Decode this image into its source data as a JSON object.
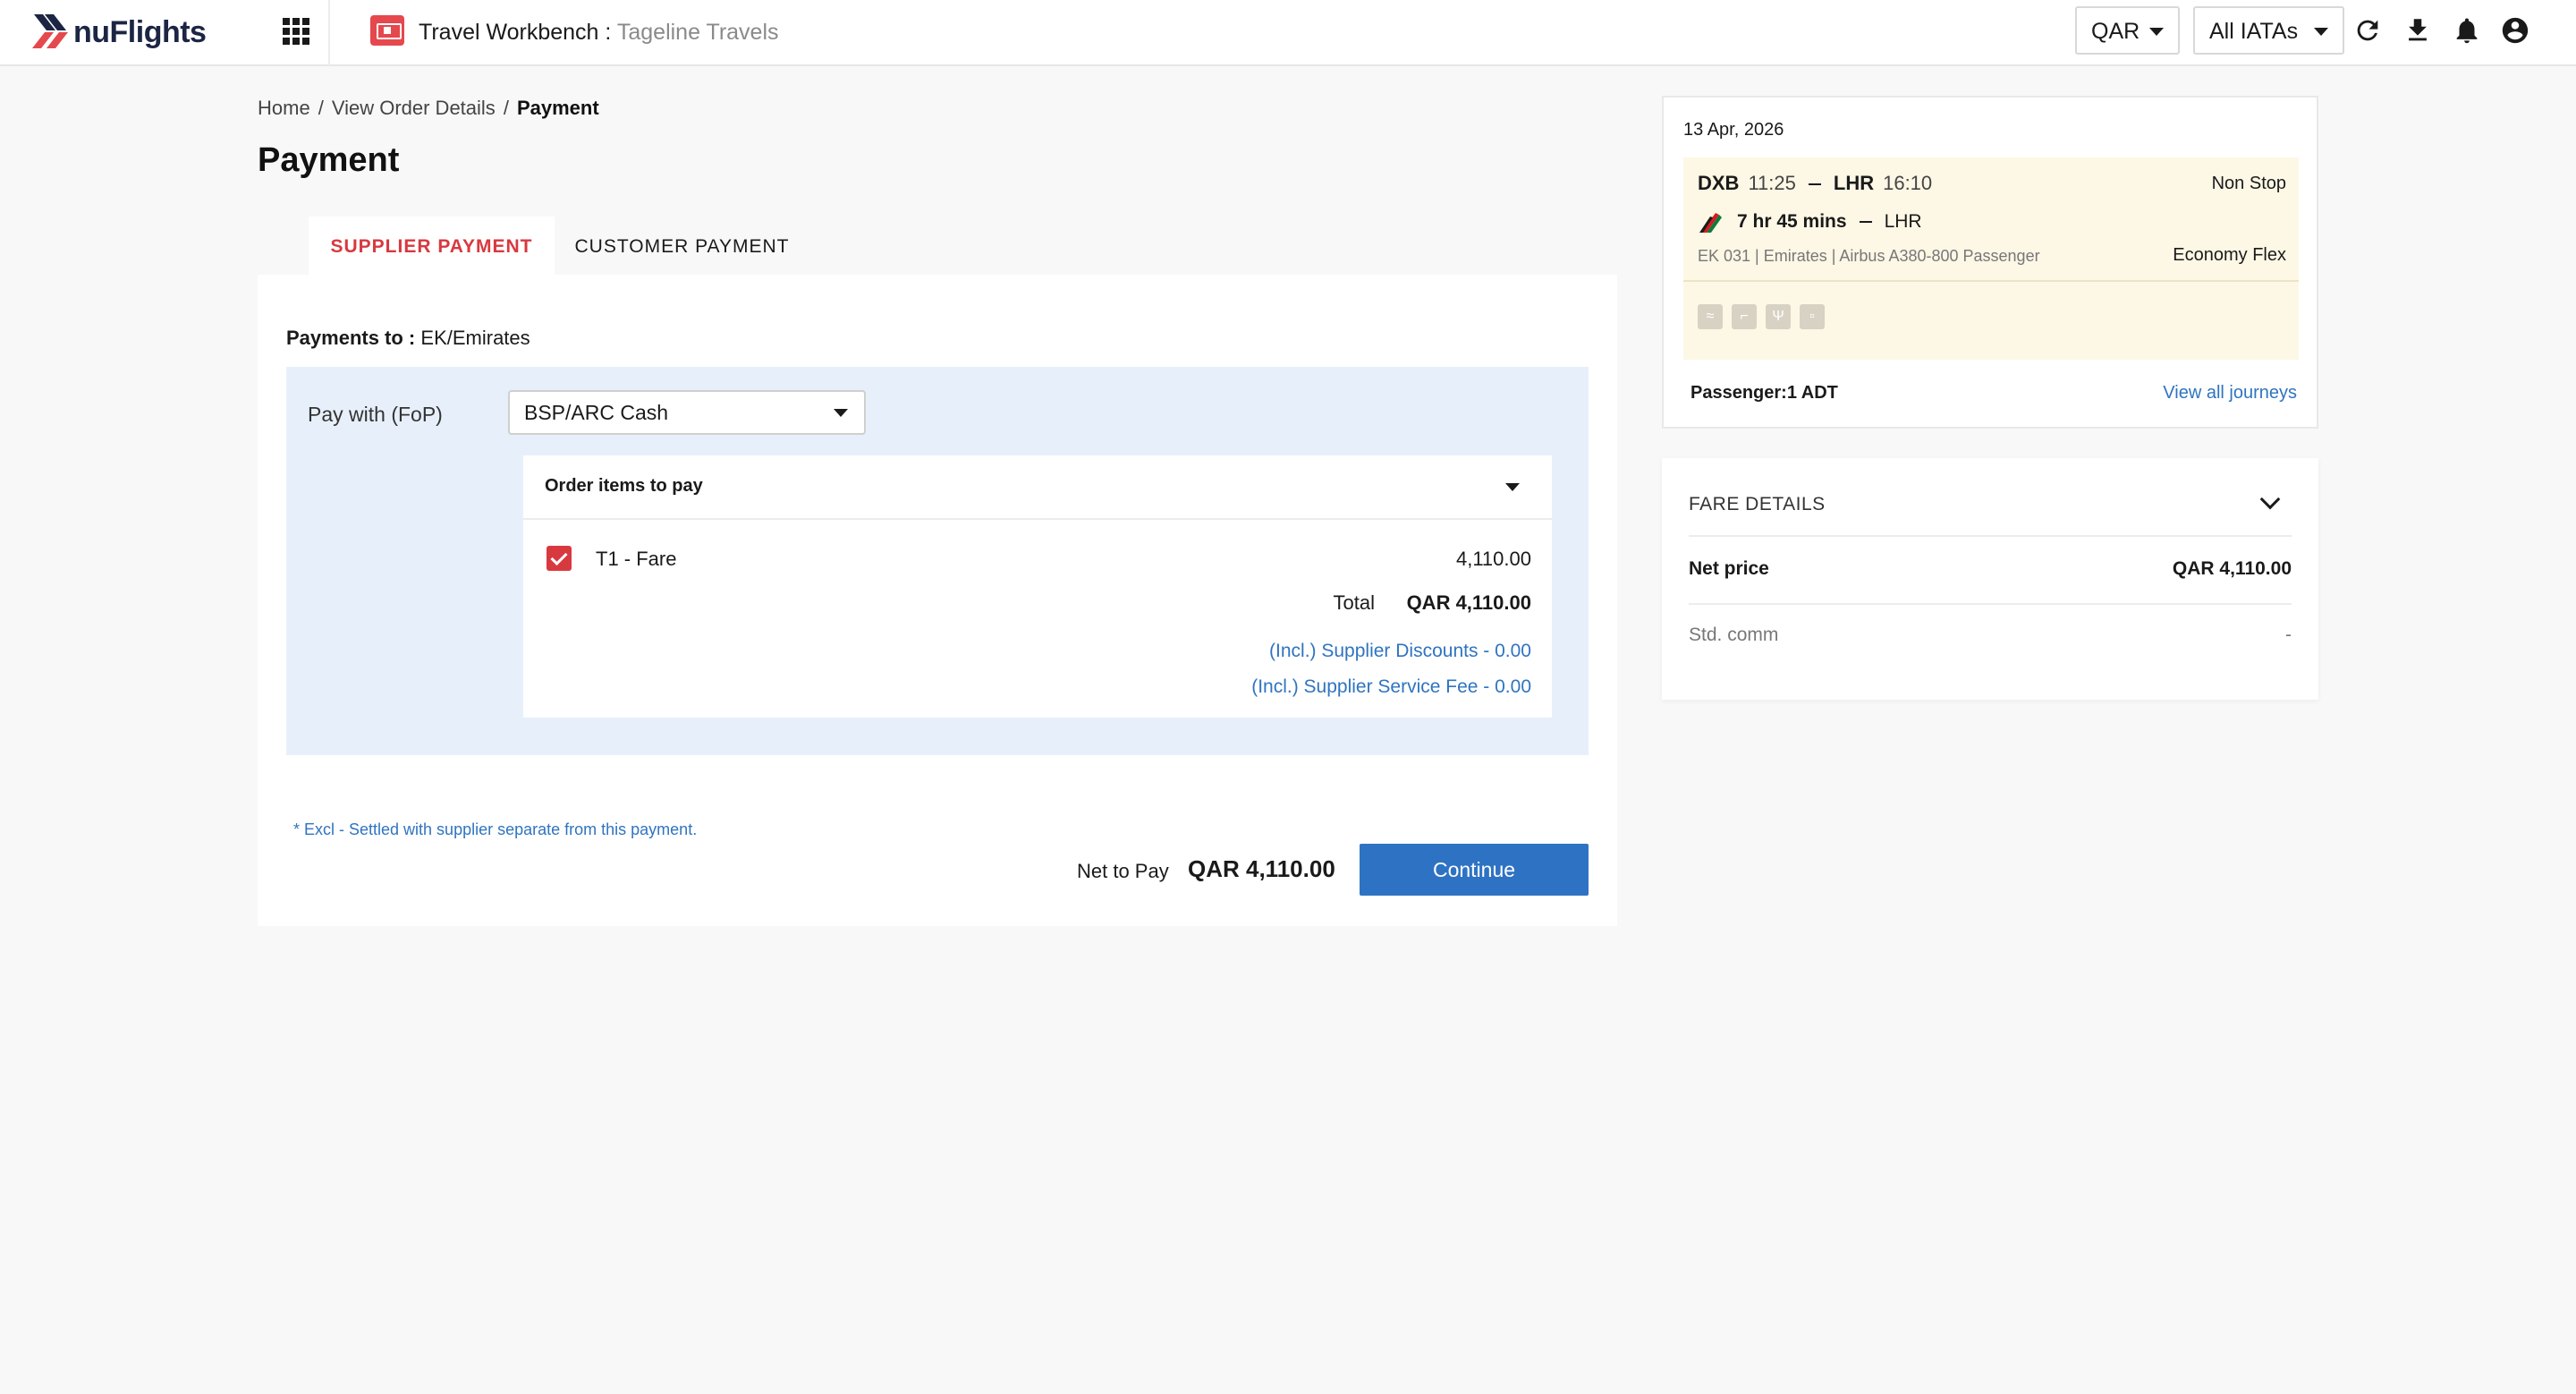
{
  "header": {
    "logo_text": "nuFlights",
    "workbench_title": "Travel Workbench :",
    "agency_name": "Tageline Travels",
    "currency": "QAR",
    "iata_filter": "All IATAs",
    "icons": [
      "apps-grid-icon",
      "workbench-icon",
      "refresh-icon",
      "download-icon",
      "bell-icon",
      "account-icon"
    ]
  },
  "breadcrumb": {
    "items": [
      "Home",
      "View Order Details"
    ],
    "separator": "/",
    "current": "Payment"
  },
  "page": {
    "title": "Payment"
  },
  "tabs": [
    {
      "label": "SUPPLIER PAYMENT",
      "active": true
    },
    {
      "label": "CUSTOMER PAYMENT",
      "active": false
    }
  ],
  "payment": {
    "payments_to_label": "Payments to :",
    "payments_to_value": "EK/Emirates",
    "fop_label": "Pay with (FoP)",
    "fop_value": "BSP/ARC Cash",
    "order_items_title": "Order items to pay",
    "items": [
      {
        "label": "T1 - Fare",
        "amount": "4,110.00",
        "checked": true
      }
    ],
    "total_label": "Total",
    "total_amount": "QAR 4,110.00",
    "supplier_discounts": "(Incl.) Supplier Discounts - 0.00",
    "supplier_service_fee": "(Incl.) Supplier Service Fee - 0.00",
    "footnote": "* Excl - Settled with supplier separate from this payment.",
    "net_to_pay_label": "Net to Pay",
    "net_to_pay_amount": "QAR 4,110.00",
    "continue_label": "Continue"
  },
  "flight": {
    "date": "13 Apr, 2026",
    "origin": "DXB",
    "departure_time": "11:25",
    "destination": "LHR",
    "arrival_time": "16:10",
    "stops": "Non Stop",
    "duration": "7 hr 45 mins",
    "duration_dest": "LHR",
    "info": "EK 031 | Emirates | Airbus A380-800 Passenger",
    "fare_class": "Economy Flex",
    "amenities": [
      "wifi-icon",
      "seat-icon",
      "meal-icon",
      "baggage-icon"
    ],
    "passengers": "Passenger:1 ADT",
    "view_all": "View all journeys"
  },
  "fare_details": {
    "title": "FARE DETAILS",
    "rows": [
      {
        "label": "Net price",
        "value": "QAR 4,110.00"
      },
      {
        "label": "Std. comm",
        "value": "-"
      }
    ]
  },
  "colors": {
    "accent_red": "#d8393f",
    "link_blue": "#2f74c0",
    "button_blue": "#2e73c3",
    "fop_bg": "#e7f0fa",
    "segment_bg": "#fdf7e5"
  }
}
